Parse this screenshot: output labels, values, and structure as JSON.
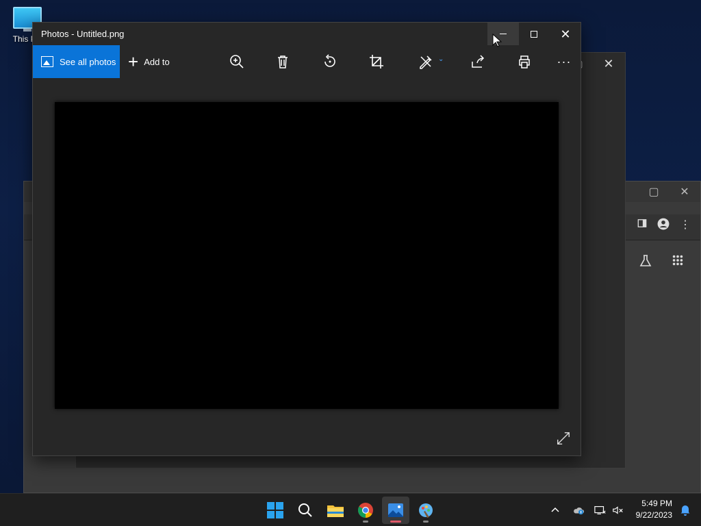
{
  "desktop": {
    "icon_label": "This PC"
  },
  "photos_window": {
    "title": "Photos - Untitled.png",
    "see_all_label": "See all photos",
    "add_to_label": "Add to"
  },
  "taskbar": {
    "time": "5:49 PM",
    "date": "9/22/2023"
  },
  "colors": {
    "accent": "#0a74d8",
    "window_bg": "#272727",
    "taskbar_bg": "#1f1f1f",
    "desktop_bg": "#0d1f45"
  }
}
